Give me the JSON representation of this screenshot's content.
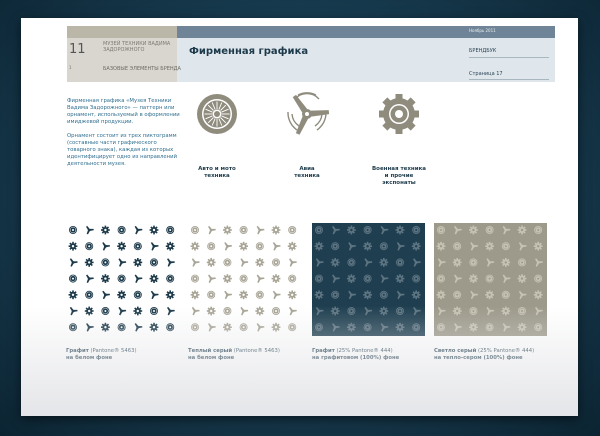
{
  "header": {
    "page_number": "11",
    "page_sub": "1",
    "museum": "Музей техники Вадима Задорожного",
    "section": "Базовые элементы бренда",
    "title": "Фирменная графика",
    "date": "Ноябрь 2011",
    "brandbook": "Брендбук",
    "page_label": "Страница 17"
  },
  "intro": {
    "p1": "Фирменная графика «Музея Техники Вадима Задорожного» — паттерн или орнамент, используемый в оформлении имиджевой продукции.",
    "p2": "Орнамент состоит из трех пиктограмм (составные части графического товарного знака), каждая из которых идентифицирует одно из направлений деятельности музея."
  },
  "icons": [
    {
      "name": "wheel-icon",
      "caption_line1": "Авто и мото",
      "caption_line2": "техника"
    },
    {
      "name": "propeller-icon",
      "caption_line1": "Авиа",
      "caption_line2": "техника"
    },
    {
      "name": "gear-icon",
      "caption_line1": "Военная техника",
      "caption_line2": "и прочие экспонаты"
    }
  ],
  "patterns": [
    {
      "bold1": "Графит",
      "rest1": " (Pantone® 5463)",
      "bold2": "на белом фоне",
      "bg": "#ffffff",
      "fg": "#1d3a4a"
    },
    {
      "bold1": "Теплый серый",
      "rest1": " (Pantone® 5463)",
      "bold2": "на белом фоне",
      "bg": "#ffffff",
      "fg": "#a8a596"
    },
    {
      "bold1": "Графит",
      "rest1": " (25% Pantone® 444)",
      "bold2": "на графитовом (100%) фоне",
      "bg": "#1f3f50",
      "fg": "#5d7482"
    },
    {
      "bold1": "Светло серый",
      "rest1": " (25% Pantone® 444)",
      "bold2": "на тепло-сером (100%) фоне",
      "bg": "#9d9a8b",
      "fg": "#c6c3b5"
    }
  ],
  "colors": {
    "icon_gray": "#8f8c7e",
    "accent_blue": "#2f6e8f",
    "graphite": "#1d3a4a"
  }
}
